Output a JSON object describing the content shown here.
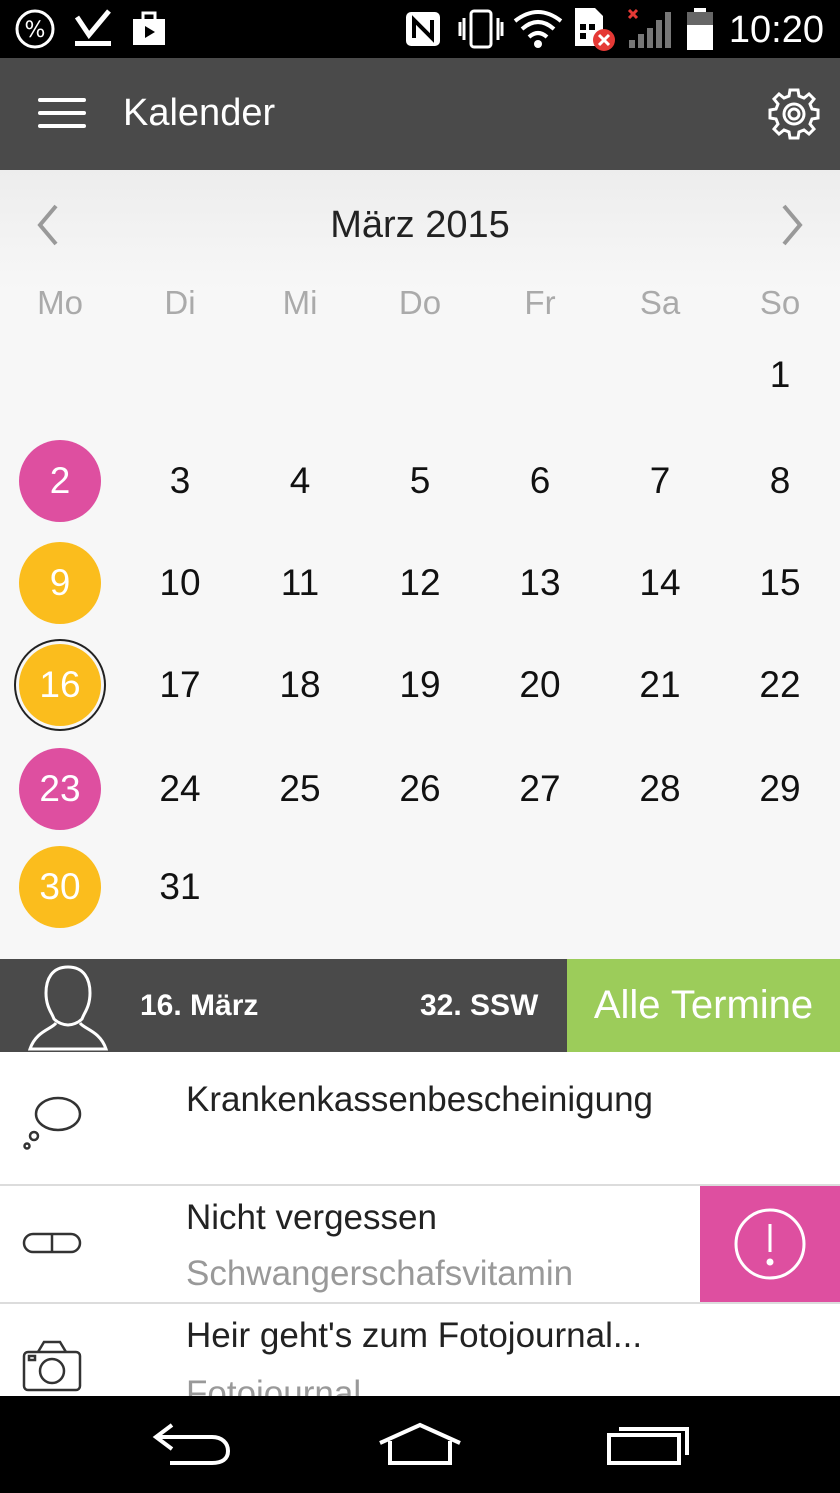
{
  "status_bar": {
    "time": "10:20"
  },
  "app_bar": {
    "title": "Kalender"
  },
  "calendar": {
    "month_label": "März 2015",
    "weekdays": [
      "Mo",
      "Di",
      "Mi",
      "Do",
      "Fr",
      "Sa",
      "So"
    ],
    "rows": [
      [
        "",
        "",
        "",
        "",
        "",
        "",
        "1"
      ],
      [
        "2",
        "3",
        "4",
        "5",
        "6",
        "7",
        "8"
      ],
      [
        "9",
        "10",
        "11",
        "12",
        "13",
        "14",
        "15"
      ],
      [
        "16",
        "17",
        "18",
        "19",
        "20",
        "21",
        "22"
      ],
      [
        "23",
        "24",
        "25",
        "26",
        "27",
        "28",
        "29"
      ],
      [
        "30",
        "31",
        "",
        "",
        "",
        "",
        ""
      ]
    ],
    "marked_days": [
      {
        "day": "2",
        "color": "#de4fa0"
      },
      {
        "day": "9",
        "color": "#fbbd1d"
      },
      {
        "day": "16",
        "color": "#fbbd1d",
        "selected": true
      },
      {
        "day": "23",
        "color": "#de4fa0"
      },
      {
        "day": "30",
        "color": "#fbbd1d"
      }
    ]
  },
  "summary": {
    "date": "16. März",
    "week": "32. SSW",
    "all_button": "Alle Termine"
  },
  "list": {
    "items": [
      {
        "icon": "speech-bubble-icon",
        "title": "Krankenkassenbescheinigung",
        "subtitle": ""
      },
      {
        "icon": "pill-icon",
        "title": "Nicht vergessen",
        "subtitle": "Schwangerschafsvitamin",
        "alert": true
      },
      {
        "icon": "camera-icon",
        "title": "Heir geht's zum Fotojournal...",
        "subtitle": "Fotojournal"
      }
    ]
  },
  "colors": {
    "pink": "#de4fa0",
    "yellow": "#fbbd1d",
    "green": "#9ccc5a",
    "dark": "#4a4a4a"
  }
}
